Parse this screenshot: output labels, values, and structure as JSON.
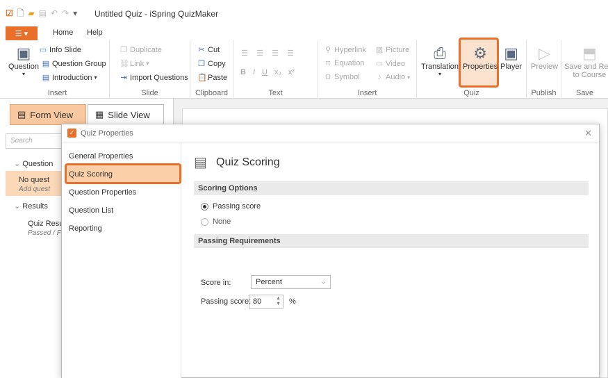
{
  "window": {
    "title": "Untitled Quiz - iSpring QuizMaker"
  },
  "ribbon_tabs": {
    "file": "☰ ▾",
    "home": "Home",
    "help": "Help"
  },
  "ribbon": {
    "insert": {
      "question": "Question",
      "info_slide": "Info Slide",
      "question_group": "Question Group",
      "introduction": "Introduction",
      "label": "Insert"
    },
    "slide": {
      "duplicate": "Duplicate",
      "link": "Link",
      "import_questions": "Import Questions",
      "label": "Slide"
    },
    "clipboard": {
      "cut": "Cut",
      "copy": "Copy",
      "paste": "Paste",
      "label": "Clipboard"
    },
    "text": {
      "bold": "B",
      "italic": "I",
      "underline": "U",
      "subscript": "x₂",
      "superscript": "x²",
      "label": "Text"
    },
    "insert2": {
      "hyperlink": "Hyperlink",
      "equation": "Equation",
      "symbol": "Symbol",
      "picture": "Picture",
      "video": "Video",
      "audio": "Audio",
      "label": "Insert"
    },
    "quiz": {
      "translation": "Translation",
      "properties": "Properties",
      "player": "Player",
      "label": "Quiz"
    },
    "publish": {
      "preview": "Preview",
      "label": "Publish"
    },
    "save": {
      "save_and_return": "Save and Retu",
      "to_course": "to Course",
      "label": "Save"
    }
  },
  "left_pane": {
    "form_view": "Form View",
    "slide_view": "Slide View",
    "search_placeholder": "Search",
    "questions": "Question",
    "no_questions": "No quest",
    "add_questions": "Add quest",
    "results": "Results",
    "quiz_result": "Quiz Resu",
    "passed": "Passed / F"
  },
  "dialog": {
    "title": "Quiz Properties",
    "nav": [
      "General Properties",
      "Quiz Scoring",
      "Question Properties",
      "Question List",
      "Reporting"
    ],
    "selected_index": 1,
    "content_title": "Quiz Scoring",
    "scoring_options": "Scoring Options",
    "passing_score_radio": "Passing score",
    "none_radio": "None",
    "passing_requirements": "Passing Requirements",
    "score_in_label": "Score in:",
    "score_in_value": "Percent",
    "passing_score_label": "Passing score:",
    "passing_score_value": "80",
    "unit": "%"
  }
}
